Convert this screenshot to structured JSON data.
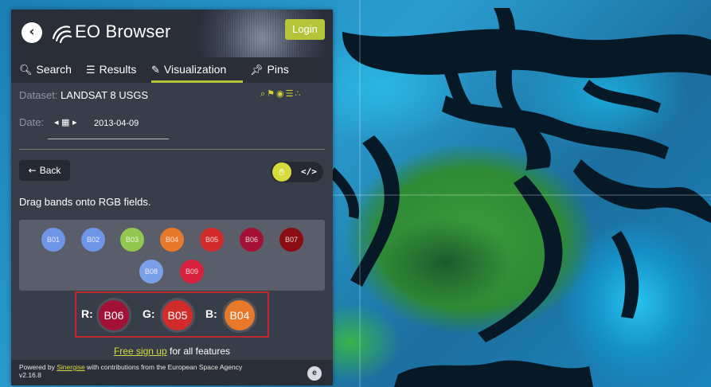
{
  "app": {
    "title": "EO Browser",
    "login_label": "Login"
  },
  "tabs": [
    {
      "label": "Search",
      "icon": "search-icon"
    },
    {
      "label": "Results",
      "icon": "list-icon"
    },
    {
      "label": "Visualization",
      "icon": "brush-icon",
      "active": true
    },
    {
      "label": "Pins",
      "icon": "pin-icon"
    }
  ],
  "dataset": {
    "label": "Dataset:",
    "value": "LANDSAT 8 USGS",
    "icons": [
      "search-icon",
      "pin-icon",
      "eye-off-icon",
      "sliders-icon",
      "share-icon"
    ]
  },
  "date": {
    "label": "Date:",
    "value": "2013-04-09"
  },
  "visualization": {
    "back_label": "Back",
    "instruction": "Drag bands onto RGB fields.",
    "bands": [
      {
        "name": "B01",
        "color": "#6f95e8"
      },
      {
        "name": "B02",
        "color": "#6f95e8"
      },
      {
        "name": "B03",
        "color": "#93c850"
      },
      {
        "name": "B04",
        "color": "#e8782a"
      },
      {
        "name": "B05",
        "color": "#d22b2b"
      },
      {
        "name": "B06",
        "color": "#a31236"
      },
      {
        "name": "B07",
        "color": "#8b0c12"
      },
      {
        "name": "B08",
        "color": "#7aa0ea"
      },
      {
        "name": "B09",
        "color": "#d8213f"
      }
    ],
    "rgb": {
      "r": {
        "label": "R:",
        "band": "B06",
        "color": "#a31236"
      },
      "g": {
        "label": "G:",
        "band": "B05",
        "color": "#d22b2b"
      },
      "b": {
        "label": "B:",
        "band": "B04",
        "color": "#e8782a"
      }
    }
  },
  "signup": {
    "link": "Free sign up",
    "rest": " for all features"
  },
  "footer": {
    "prefix": "Powered by ",
    "link": "Sinergise",
    "suffix": " with contributions from the European Space Agency",
    "version": "v2.16.8"
  },
  "colors": {
    "accent": "#b6c43a",
    "panel": "#383d4a",
    "header": "#2a2e39",
    "highlight": "#c0282d"
  }
}
